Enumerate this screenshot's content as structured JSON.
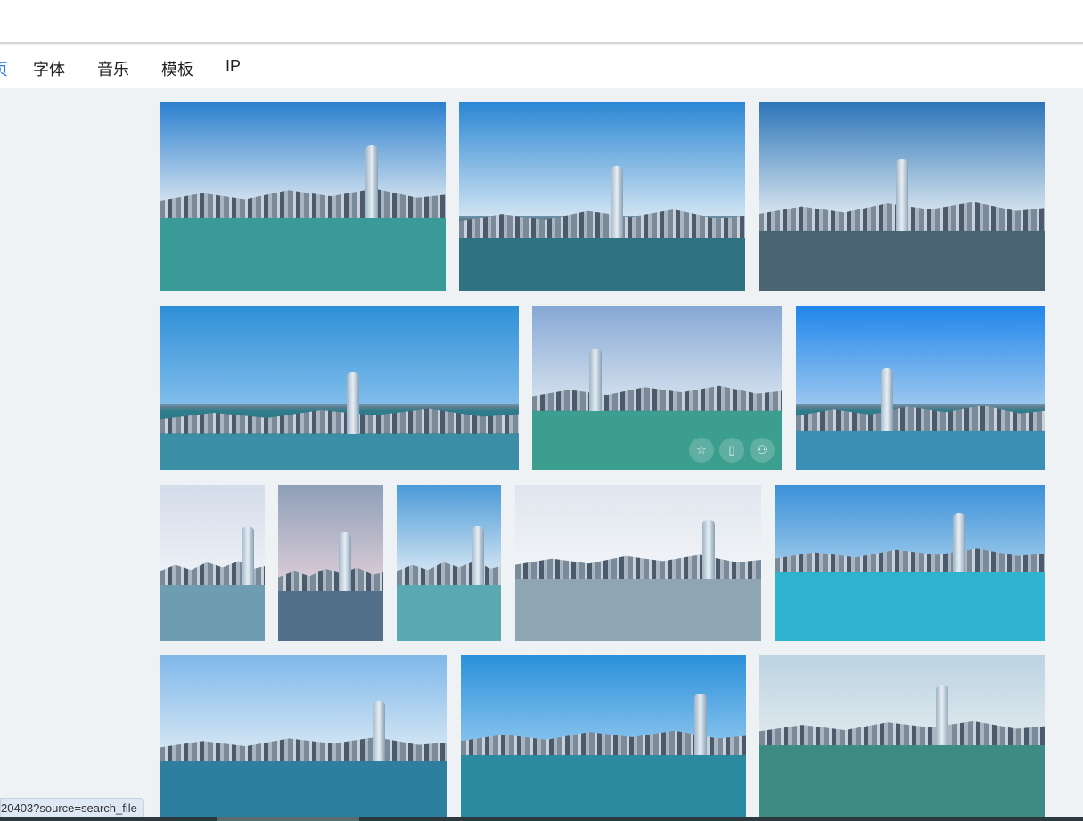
{
  "nav": {
    "items": [
      {
        "label": "页",
        "active": true
      },
      {
        "label": "字体"
      },
      {
        "label": "音乐"
      },
      {
        "label": "模板"
      },
      {
        "label": "IP"
      }
    ]
  },
  "gallery": {
    "images": [
      {
        "alt": "hong-kong-aerial"
      },
      {
        "alt": "victoria-harbour-skyline"
      },
      {
        "alt": "victoria-harbour-clouds"
      },
      {
        "alt": "hong-kong-skyline-blue"
      },
      {
        "alt": "hong-kong-skyline-green-water"
      },
      {
        "alt": "hong-kong-skyline-bright"
      },
      {
        "alt": "skyline-cloudy-1"
      },
      {
        "alt": "skyline-cloudy-2"
      },
      {
        "alt": "skyline-tall"
      },
      {
        "alt": "skyline-hazy"
      },
      {
        "alt": "skyline-dusk-lights"
      },
      {
        "alt": "skyline-ferry"
      },
      {
        "alt": "skyline-clear-blue"
      },
      {
        "alt": "skyline-pale"
      }
    ],
    "hover_actions": [
      {
        "icon": "star-icon"
      },
      {
        "icon": "book-icon"
      },
      {
        "icon": "user-icon"
      }
    ]
  },
  "status_bar": {
    "url": "20403?source=search_file"
  }
}
